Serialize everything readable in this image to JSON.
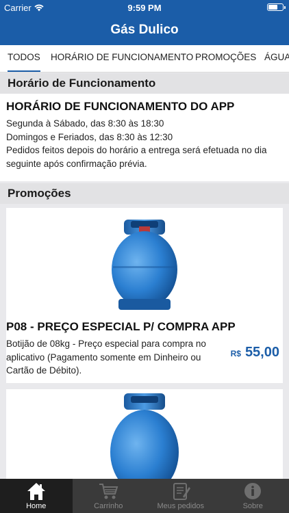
{
  "status": {
    "carrier": "Carrier",
    "time": "9:59 PM"
  },
  "nav": {
    "title": "Gás Dulico"
  },
  "tabs": [
    "TODOS",
    "HORÁRIO DE FUNCIONAMENTO",
    "PROMOÇÕES",
    "ÁGUA"
  ],
  "active_tab": "TODOS",
  "sections": {
    "hours_header": "Horário de Funcionamento",
    "promos_header": "Promoções"
  },
  "hours": {
    "title": "HORÁRIO DE FUNCIONAMENTO DO APP",
    "line1": "Segunda à Sábado, das 8:30 às 18:30",
    "line2": "Domingos e Feriados, das 8:30 às 12:30",
    "line3": "Pedidos feitos depois do horário a entrega será efetuada no dia seguinte após confirmação prévia."
  },
  "products": [
    {
      "title": "P08 - PREÇO ESPECIAL P/ COMPRA APP",
      "description": "Botijão de 08kg - Preço especial para compra no aplicativo (Pagamento somente em Dinheiro ou Cartão de Débito).",
      "currency": "R$",
      "price": "55,00"
    }
  ],
  "tabbar": [
    {
      "label": "Home",
      "icon": "home-icon",
      "active": true
    },
    {
      "label": "Carrinho",
      "icon": "cart-icon",
      "active": false
    },
    {
      "label": "Meus pedidos",
      "icon": "orders-icon",
      "active": false
    },
    {
      "label": "Sobre",
      "icon": "info-icon",
      "active": false
    }
  ],
  "colors": {
    "brand": "#1b5da8",
    "price": "#1b5da8",
    "tabbar": "#3a3a3a",
    "tabbar_active": "#1e1e1e"
  }
}
